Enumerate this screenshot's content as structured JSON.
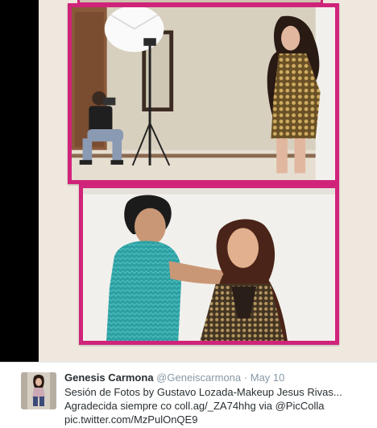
{
  "tweet": {
    "author_name": "Genesis Carmona",
    "author_handle": "@Geneiscarmona",
    "separator": "·",
    "time": "May 10",
    "text_line1": "Sesión de Fotos by Gustavo Lozada-Makeup Jesus Rivas...",
    "text_line2_prefix": "Agradecida siempre co coll.ag/_ZA74hhg via ",
    "text_line2_mention": "@PicColla",
    "text_line3": "pic.twitter.com/MzPulOnQE9"
  },
  "colors": {
    "frame_border": "#d0237a",
    "collage_background": "#efe8df",
    "left_bar": "#000000"
  },
  "images": {
    "top_photo": "photoshoot-studio-photo",
    "bottom_photo": "makeup-session-photo",
    "avatar": "profile-photo"
  }
}
